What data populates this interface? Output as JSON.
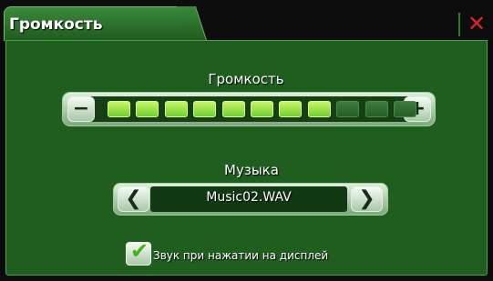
{
  "window": {
    "title": "Громкость",
    "close_icon": "close-icon"
  },
  "volume": {
    "label": "Громкость",
    "minus_label": "−",
    "plus_label": "+",
    "segments_total": 11,
    "level": 8
  },
  "music": {
    "label": "Музыка",
    "value": "Music02.WAV",
    "prev_label": "❮",
    "next_label": "❯"
  },
  "touch_sound": {
    "label": "Звук при нажатии на дисплей",
    "checked": true,
    "check_glyph": "✔"
  },
  "colors": {
    "accent": "#1f5e1f",
    "segment_on": "#9be04a",
    "close": "#e0251f"
  }
}
